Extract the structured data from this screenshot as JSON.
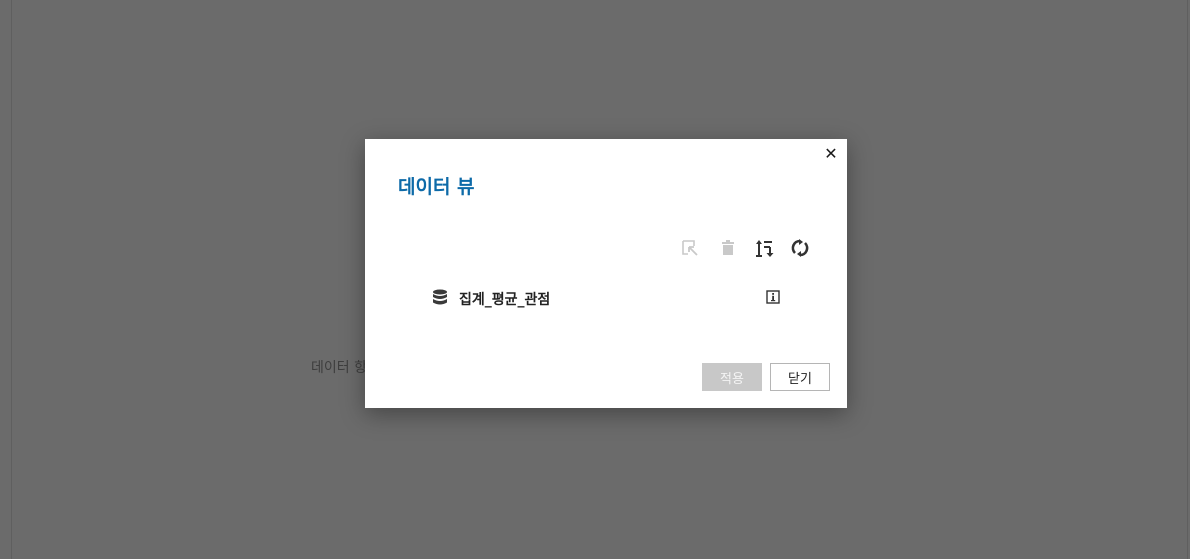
{
  "background": {
    "text": "데이터 항"
  },
  "dialog": {
    "title": "데이터 뷰",
    "close_symbol": "✕",
    "toolbar": {
      "icons": [
        "edit-select-icon",
        "trash-icon",
        "sort-order-icon",
        "refresh-icon"
      ]
    },
    "items": [
      {
        "label": "집계_평균_관점",
        "icon": "database-icon",
        "action_icon": "info-icon"
      }
    ],
    "buttons": {
      "apply": "적용",
      "close": "닫기"
    }
  },
  "colors": {
    "overlay": "#6b6b6b",
    "title": "#0d6aa8",
    "disabled_button": "#c8c8c8"
  }
}
